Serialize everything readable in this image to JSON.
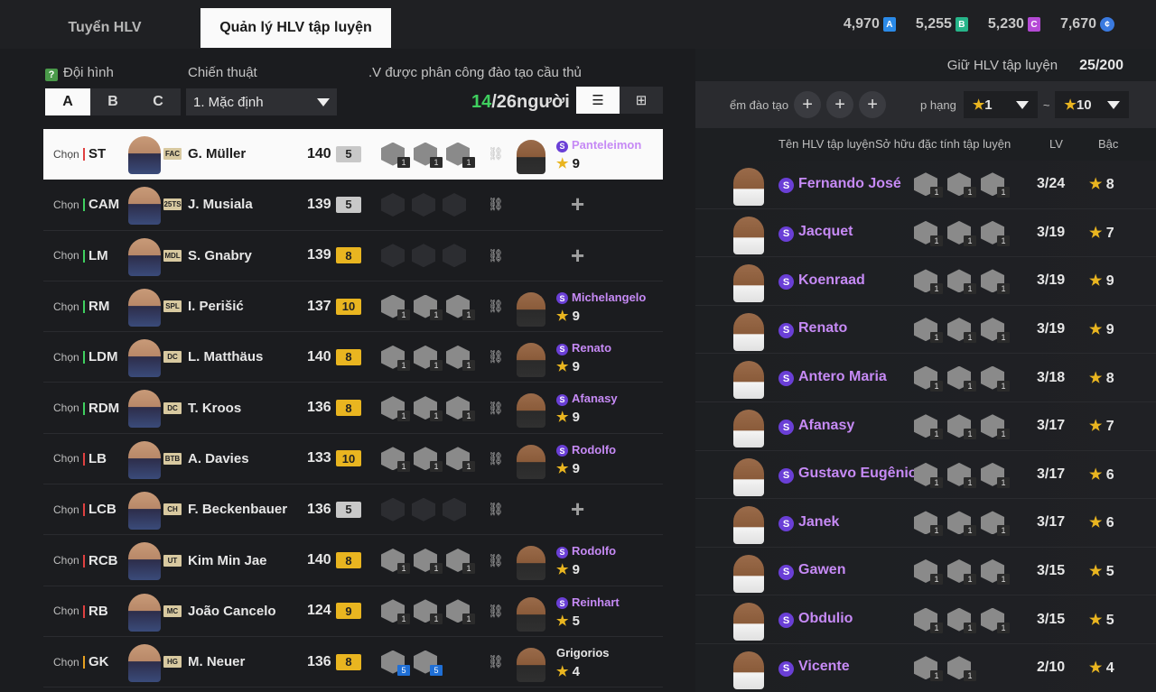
{
  "tabs": [
    "Tuyển HLV",
    "Quản lý HLV tập luyện"
  ],
  "currencies": [
    {
      "value": "4,970",
      "icon": "A",
      "color": "#2a8ae8"
    },
    {
      "value": "5,255",
      "icon": "B",
      "color": "#27b58a"
    },
    {
      "value": "5,230",
      "icon": "C",
      "color": "#b54ad6"
    },
    {
      "value": "7,670",
      "icon": "CP",
      "color": "#3a7ae0"
    }
  ],
  "filters": {
    "formation_label": "Đội hình",
    "teams": [
      "A",
      "B",
      "C"
    ],
    "tactic_label": "Chiến thuật",
    "tactic_value": "1. Mặc định",
    "assigned_label": ".V được phân công đào tạo cầu thủ",
    "assigned_count": "14",
    "assigned_total": "/26người"
  },
  "players": [
    {
      "pos": "ST",
      "club": "FAC",
      "name": "G. Müller",
      "ovr": "140",
      "grade": "5",
      "traits": [
        "1",
        "1",
        "1"
      ],
      "coach": "Panteleimon",
      "stars": "9",
      "selected": true
    },
    {
      "pos": "CAM",
      "club": "25TS",
      "name": "J. Musiala",
      "ovr": "139",
      "grade": "5",
      "traits": [],
      "coach": "",
      "stars": ""
    },
    {
      "pos": "LM",
      "club": "MDL",
      "name": "S. Gnabry",
      "ovr": "139",
      "grade": "8",
      "traits": [],
      "coach": "",
      "stars": ""
    },
    {
      "pos": "RM",
      "club": "SPL",
      "name": "I. Perišić",
      "ovr": "137",
      "grade": "10",
      "traits": [
        "1",
        "1",
        "1"
      ],
      "coach": "Michelangelo",
      "stars": "9"
    },
    {
      "pos": "LDM",
      "club": "DC",
      "name": "L. Matthäus",
      "ovr": "140",
      "grade": "8",
      "traits": [
        "1",
        "1",
        "1"
      ],
      "coach": "Renato",
      "stars": "9"
    },
    {
      "pos": "RDM",
      "club": "DC",
      "name": "T. Kroos",
      "ovr": "136",
      "grade": "8",
      "traits": [
        "1",
        "1",
        "1"
      ],
      "coach": "Afanasy",
      "stars": "9"
    },
    {
      "pos": "LB",
      "club": "BTB",
      "name": "A. Davies",
      "ovr": "133",
      "grade": "10",
      "traits": [
        "1",
        "1",
        "1"
      ],
      "coach": "Rodolfo",
      "stars": "9"
    },
    {
      "pos": "LCB",
      "club": "CH",
      "name": "F. Beckenbauer",
      "ovr": "136",
      "grade": "5",
      "traits": [],
      "coach": "",
      "stars": ""
    },
    {
      "pos": "RCB",
      "club": "UT",
      "name": "Kim Min Jae",
      "ovr": "140",
      "grade": "8",
      "traits": [
        "1",
        "1",
        "1"
      ],
      "coach": "Rodolfo",
      "stars": "9"
    },
    {
      "pos": "RB",
      "club": "MC",
      "name": "João Cancelo",
      "ovr": "124",
      "grade": "9",
      "traits": [
        "1",
        "1",
        "1"
      ],
      "coach": "Reinhart",
      "stars": "5"
    },
    {
      "pos": "GK",
      "club": "HG",
      "name": "M. Neuer",
      "ovr": "136",
      "grade": "8",
      "traits": [
        "5",
        "5"
      ],
      "coach": "Grigorios",
      "stars": "4",
      "plain": true
    }
  ],
  "chon_label": "Chọn",
  "right": {
    "keep_label": "Giữ HLV tập luyện",
    "keep_value": "25/200",
    "filter_points": "ểm đào tạo",
    "filter_rank": "p hạng",
    "rank_from": "1",
    "rank_to": "10",
    "range_sep": "~",
    "col_name": "Tên HLV tập luyện",
    "col_traits": "Sở hữu đặc tính tập luyện",
    "col_lv": "LV",
    "col_grade": "Bậc"
  },
  "coaches": [
    {
      "name": "Fernando José",
      "lv": "3/24",
      "stars": "8"
    },
    {
      "name": "Jacquet",
      "lv": "3/19",
      "stars": "7"
    },
    {
      "name": "Koenraad",
      "lv": "3/19",
      "stars": "9"
    },
    {
      "name": "Renato",
      "lv": "3/19",
      "stars": "9"
    },
    {
      "name": "Antero Maria",
      "lv": "3/18",
      "stars": "8"
    },
    {
      "name": "Afanasy",
      "lv": "3/17",
      "stars": "7"
    },
    {
      "name": "Gustavo Eugênio",
      "lv": "3/17",
      "stars": "6"
    },
    {
      "name": "Janek",
      "lv": "3/17",
      "stars": "6"
    },
    {
      "name": "Gawen",
      "lv": "3/15",
      "stars": "5"
    },
    {
      "name": "Obdulio",
      "lv": "3/15",
      "stars": "5"
    },
    {
      "name": "Vicente",
      "lv": "2/10",
      "stars": "4"
    }
  ]
}
